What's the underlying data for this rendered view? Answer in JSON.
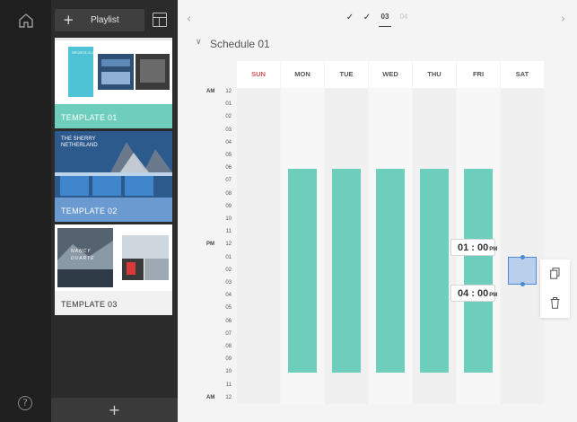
{
  "rail": {
    "home_icon": "home-icon",
    "help_label": "?"
  },
  "panel": {
    "playlist_label": "Playlist",
    "add_icon": "plus-icon",
    "layout_icon": "layout-icon",
    "templates": [
      {
        "label": "TEMPLATE 01",
        "thumb_text": "SPORTS CLUB"
      },
      {
        "label": "TEMPLATE 02",
        "thumb_text": "THE SHERRY NETHERLAND"
      },
      {
        "label": "TEMPLATE 03",
        "thumb_text": "NANCY DUARTE"
      }
    ],
    "bottom_add": "+"
  },
  "main": {
    "steps": [
      "03",
      "04"
    ],
    "schedule_title": "Schedule 01",
    "days": [
      "SUN",
      "MON",
      "TUE",
      "WED",
      "THU",
      "FRI",
      "SAT"
    ],
    "hours": [
      "12",
      "01",
      "02",
      "03",
      "04",
      "05",
      "06",
      "07",
      "08",
      "09",
      "10",
      "11",
      "12",
      "01",
      "02",
      "03",
      "04",
      "05",
      "06",
      "07",
      "08",
      "09",
      "10",
      "11",
      "12"
    ],
    "am_label": "AM",
    "pm_label": "PM",
    "start_time": {
      "hm": "01 : 00",
      "suffix": "PM"
    },
    "end_time": {
      "hm": "04 : 00",
      "suffix": "PM"
    },
    "colors": {
      "block": "#6dcfbb",
      "selection": "#b9cfeb",
      "accent": "#4a8ad9",
      "sunday": "#d2585b"
    }
  }
}
